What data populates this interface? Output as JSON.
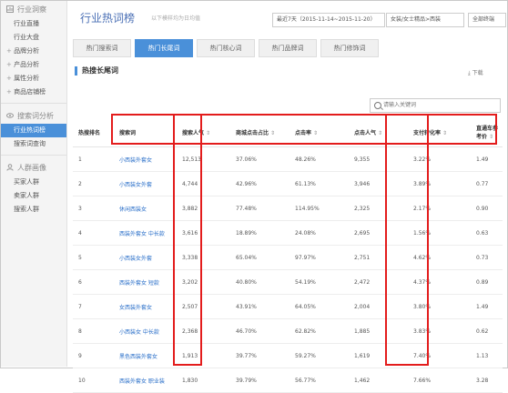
{
  "sidebar": {
    "section1": "行业洞察",
    "items1": [
      "行业直播",
      "行业大盘",
      "品牌分析",
      "产品分析",
      "属性分析",
      "商品店铺榜"
    ],
    "section2": "搜索词分析",
    "items2": [
      "行业热词榜",
      "搜索词查询"
    ],
    "section3": "人群画像",
    "items3": [
      "买家人群",
      "卖家人群",
      "搜索人群"
    ]
  },
  "header": {
    "title": "行业热词榜",
    "subtitle": "以下模样均为日均值",
    "date_range": "最近7天（2015-11-14~2015-11-20）",
    "category": "女装/女士精品>西装",
    "terminal": "全部终端"
  },
  "tabs": [
    "热门搜索词",
    "热门长尾词",
    "热门核心词",
    "热门品牌词",
    "热门修饰词"
  ],
  "section_title": "热搜长尾词",
  "download_label": "下载",
  "search": {
    "placeholder": "请输入关键词"
  },
  "table": {
    "headers": [
      "热搜排名",
      "搜索词",
      "搜索人气",
      "商城点击占比",
      "点击率",
      "点击人气",
      "支付转化率",
      "直通车参考价"
    ],
    "rows": [
      [
        "1",
        "小西装外套女",
        "12,513",
        "37.06%",
        "48.26%",
        "9,355",
        "3.22%",
        "1.49"
      ],
      [
        "2",
        "小西装女外套",
        "4,744",
        "42.96%",
        "61.13%",
        "3,946",
        "3.89%",
        "0.77"
      ],
      [
        "3",
        "休闲西装女",
        "3,882",
        "77.48%",
        "114.95%",
        "2,325",
        "2.17%",
        "0.90"
      ],
      [
        "4",
        "西装外套女 中长款",
        "3,616",
        "18.89%",
        "24.08%",
        "2,695",
        "1.56%",
        "0.63"
      ],
      [
        "5",
        "小西装女外套",
        "3,338",
        "65.04%",
        "97.97%",
        "2,751",
        "4.62%",
        "0.73"
      ],
      [
        "6",
        "西装外套女 短款",
        "3,202",
        "40.80%",
        "54.19%",
        "2,472",
        "4.37%",
        "0.89"
      ],
      [
        "7",
        "女西装外套女",
        "2,507",
        "43.91%",
        "64.05%",
        "2,004",
        "3.80%",
        "1.49"
      ],
      [
        "8",
        "小西装女 中长款",
        "2,368",
        "46.70%",
        "62.82%",
        "1,885",
        "3.83%",
        "0.62"
      ],
      [
        "9",
        "黑色西装外套女",
        "1,913",
        "39.77%",
        "59.27%",
        "1,619",
        "7.40%",
        "1.13"
      ],
      [
        "10",
        "西装外套女 职业装",
        "1,830",
        "39.79%",
        "56.77%",
        "1,462",
        "7.66%",
        "3.28"
      ]
    ]
  },
  "colors": {
    "accent": "#4a90d9",
    "highlight": "#e31c1c",
    "link": "#2a6fc9"
  }
}
